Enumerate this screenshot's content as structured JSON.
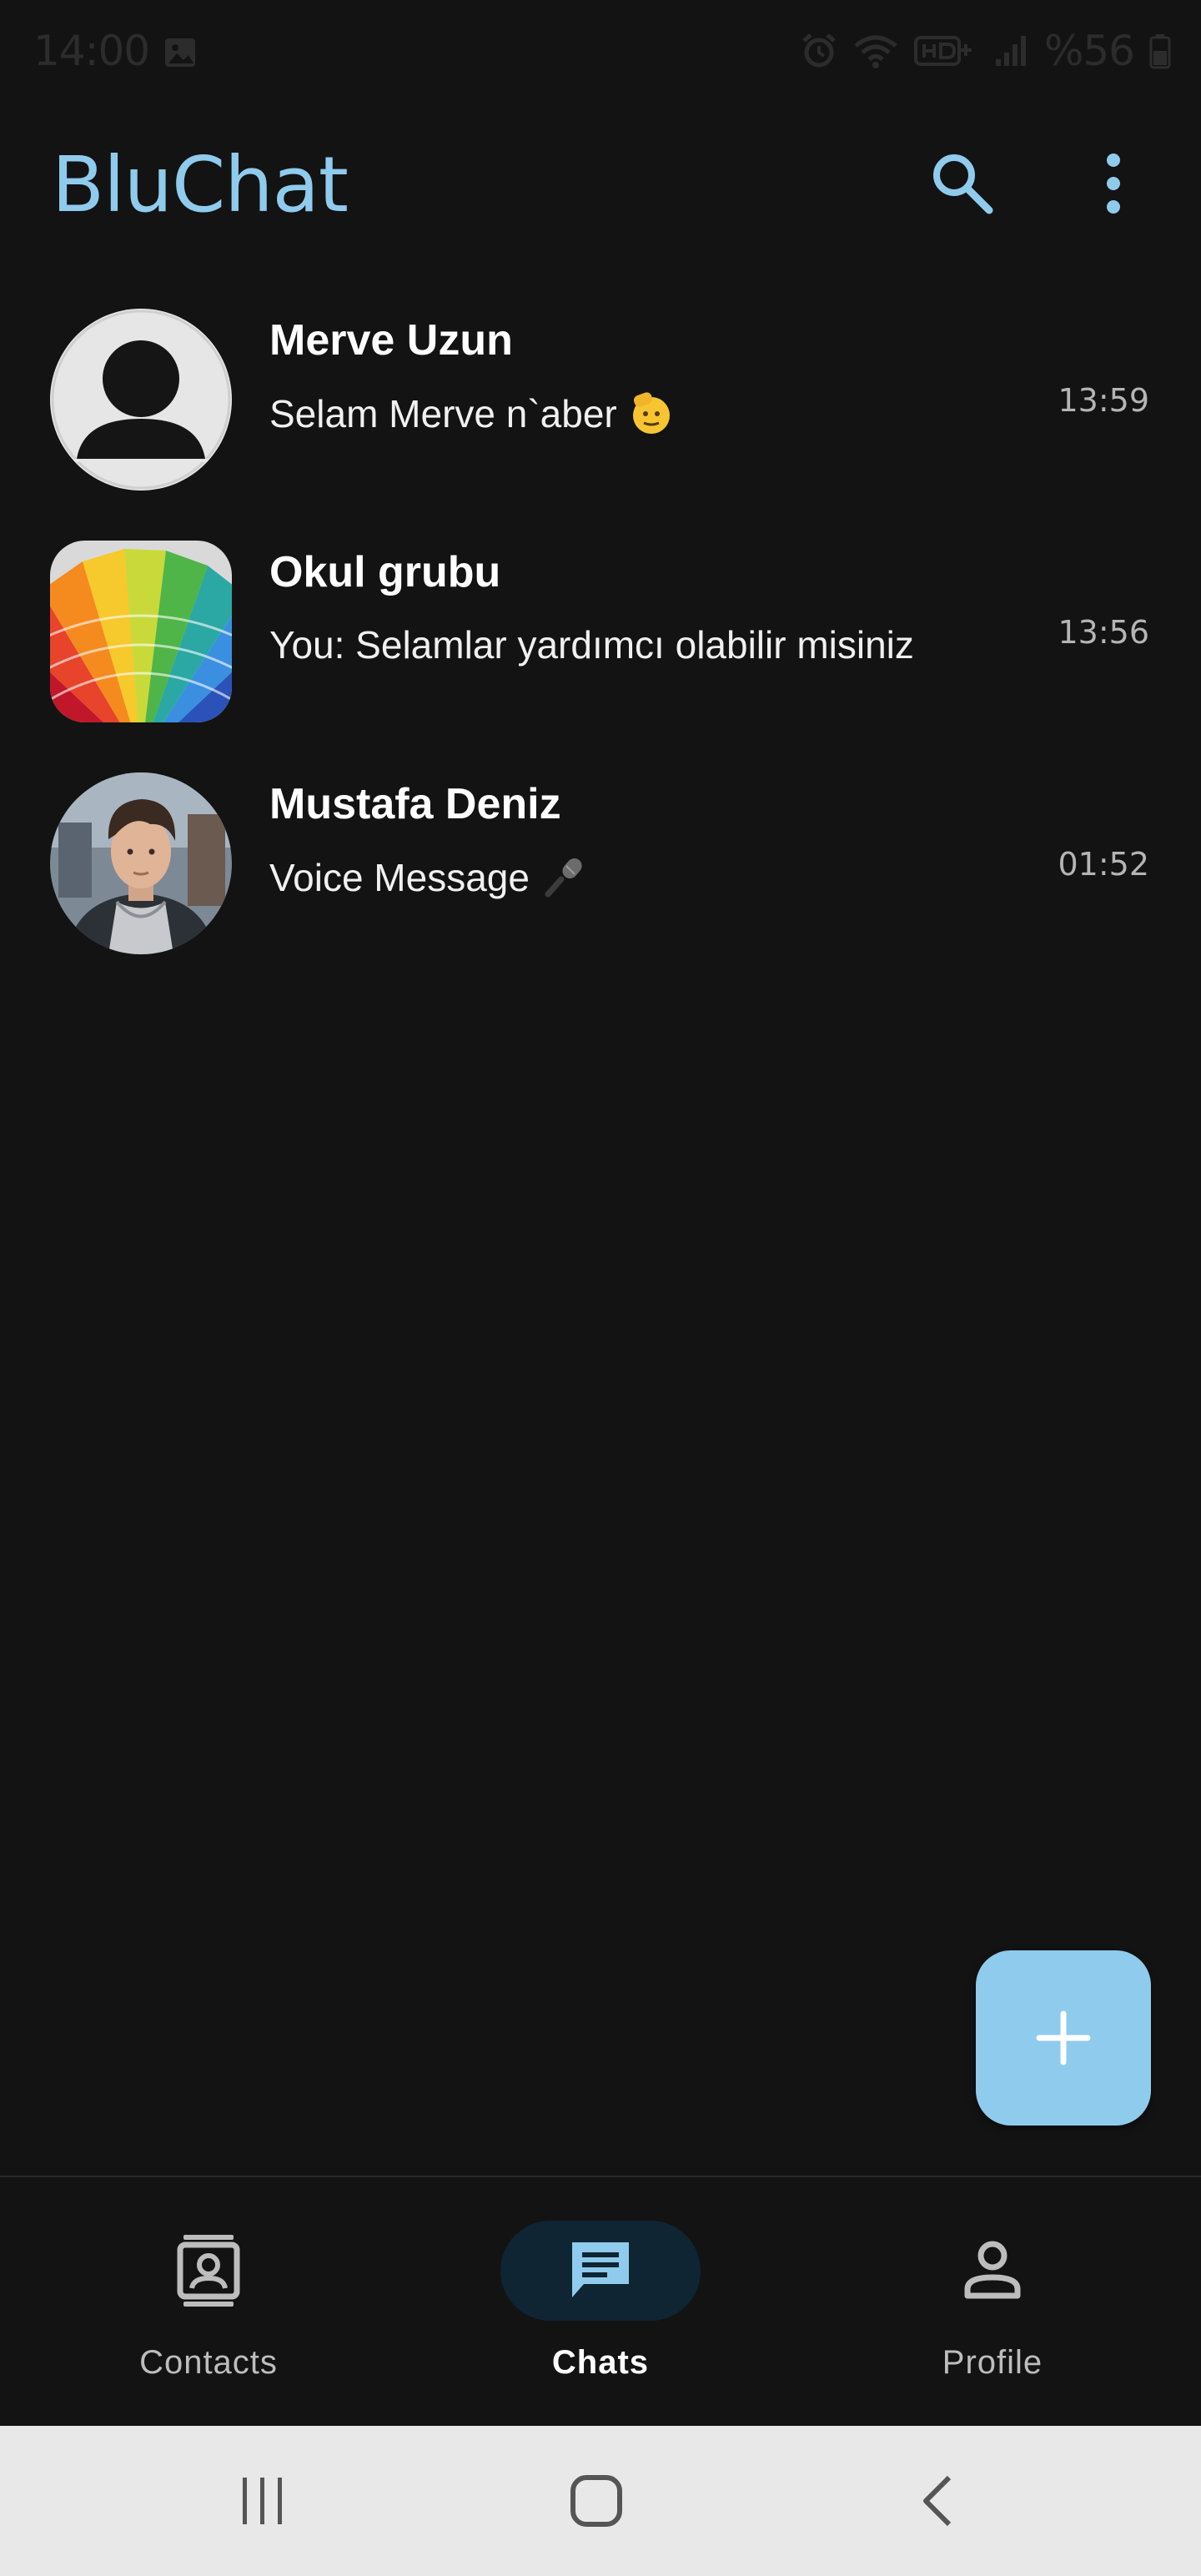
{
  "status_bar": {
    "time": "14:00",
    "battery": "%56"
  },
  "app": {
    "title": "BluChat",
    "accent_color": "#8fcbec"
  },
  "chats": [
    {
      "name": "Merve Uzun",
      "preview": "Selam Merve n`aber",
      "preview_emoji": "saluting-face-emoji",
      "time": "13:59",
      "avatar": "default-person-avatar"
    },
    {
      "name": "Okul grubu",
      "preview": "You: Selamlar yardımcı olabilir misiniz",
      "time": "13:56",
      "avatar": "color-palette-avatar"
    },
    {
      "name": "Mustafa Deniz",
      "preview": "Voice Message",
      "preview_emoji": "microphone-emoji",
      "time": "01:52",
      "avatar": "person-photo-avatar"
    }
  ],
  "bottom_nav": {
    "items": [
      {
        "label": "Contacts",
        "icon": "contacts-icon",
        "active": false
      },
      {
        "label": "Chats",
        "icon": "chat-icon",
        "active": true
      },
      {
        "label": "Profile",
        "icon": "person-icon",
        "active": false
      }
    ]
  },
  "fab": {
    "icon": "plus-icon"
  }
}
